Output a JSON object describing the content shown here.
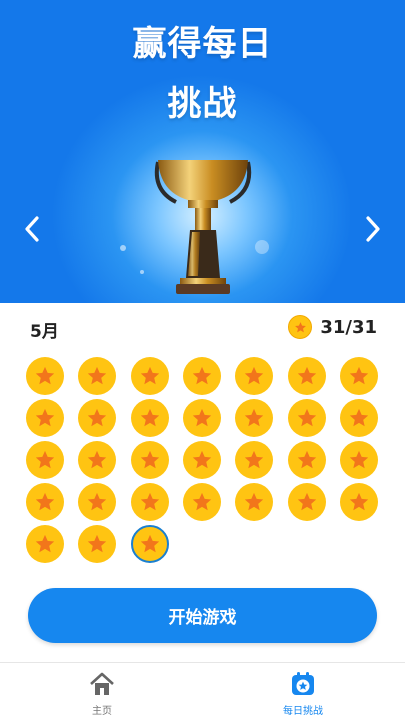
{
  "hero": {
    "title_line1": "赢得每日",
    "title_line2": "挑战"
  },
  "calendar": {
    "month": "5月",
    "score": "31/31",
    "total_days": 31,
    "today": 31,
    "coin_color": "#ffc412",
    "star_color": "#f2761b"
  },
  "cta": {
    "label": "开始游戏"
  },
  "tabs": [
    {
      "label": "主页",
      "icon": "home-icon",
      "active": false
    },
    {
      "label": "每日挑战",
      "icon": "calendar-star-icon",
      "active": true
    }
  ]
}
